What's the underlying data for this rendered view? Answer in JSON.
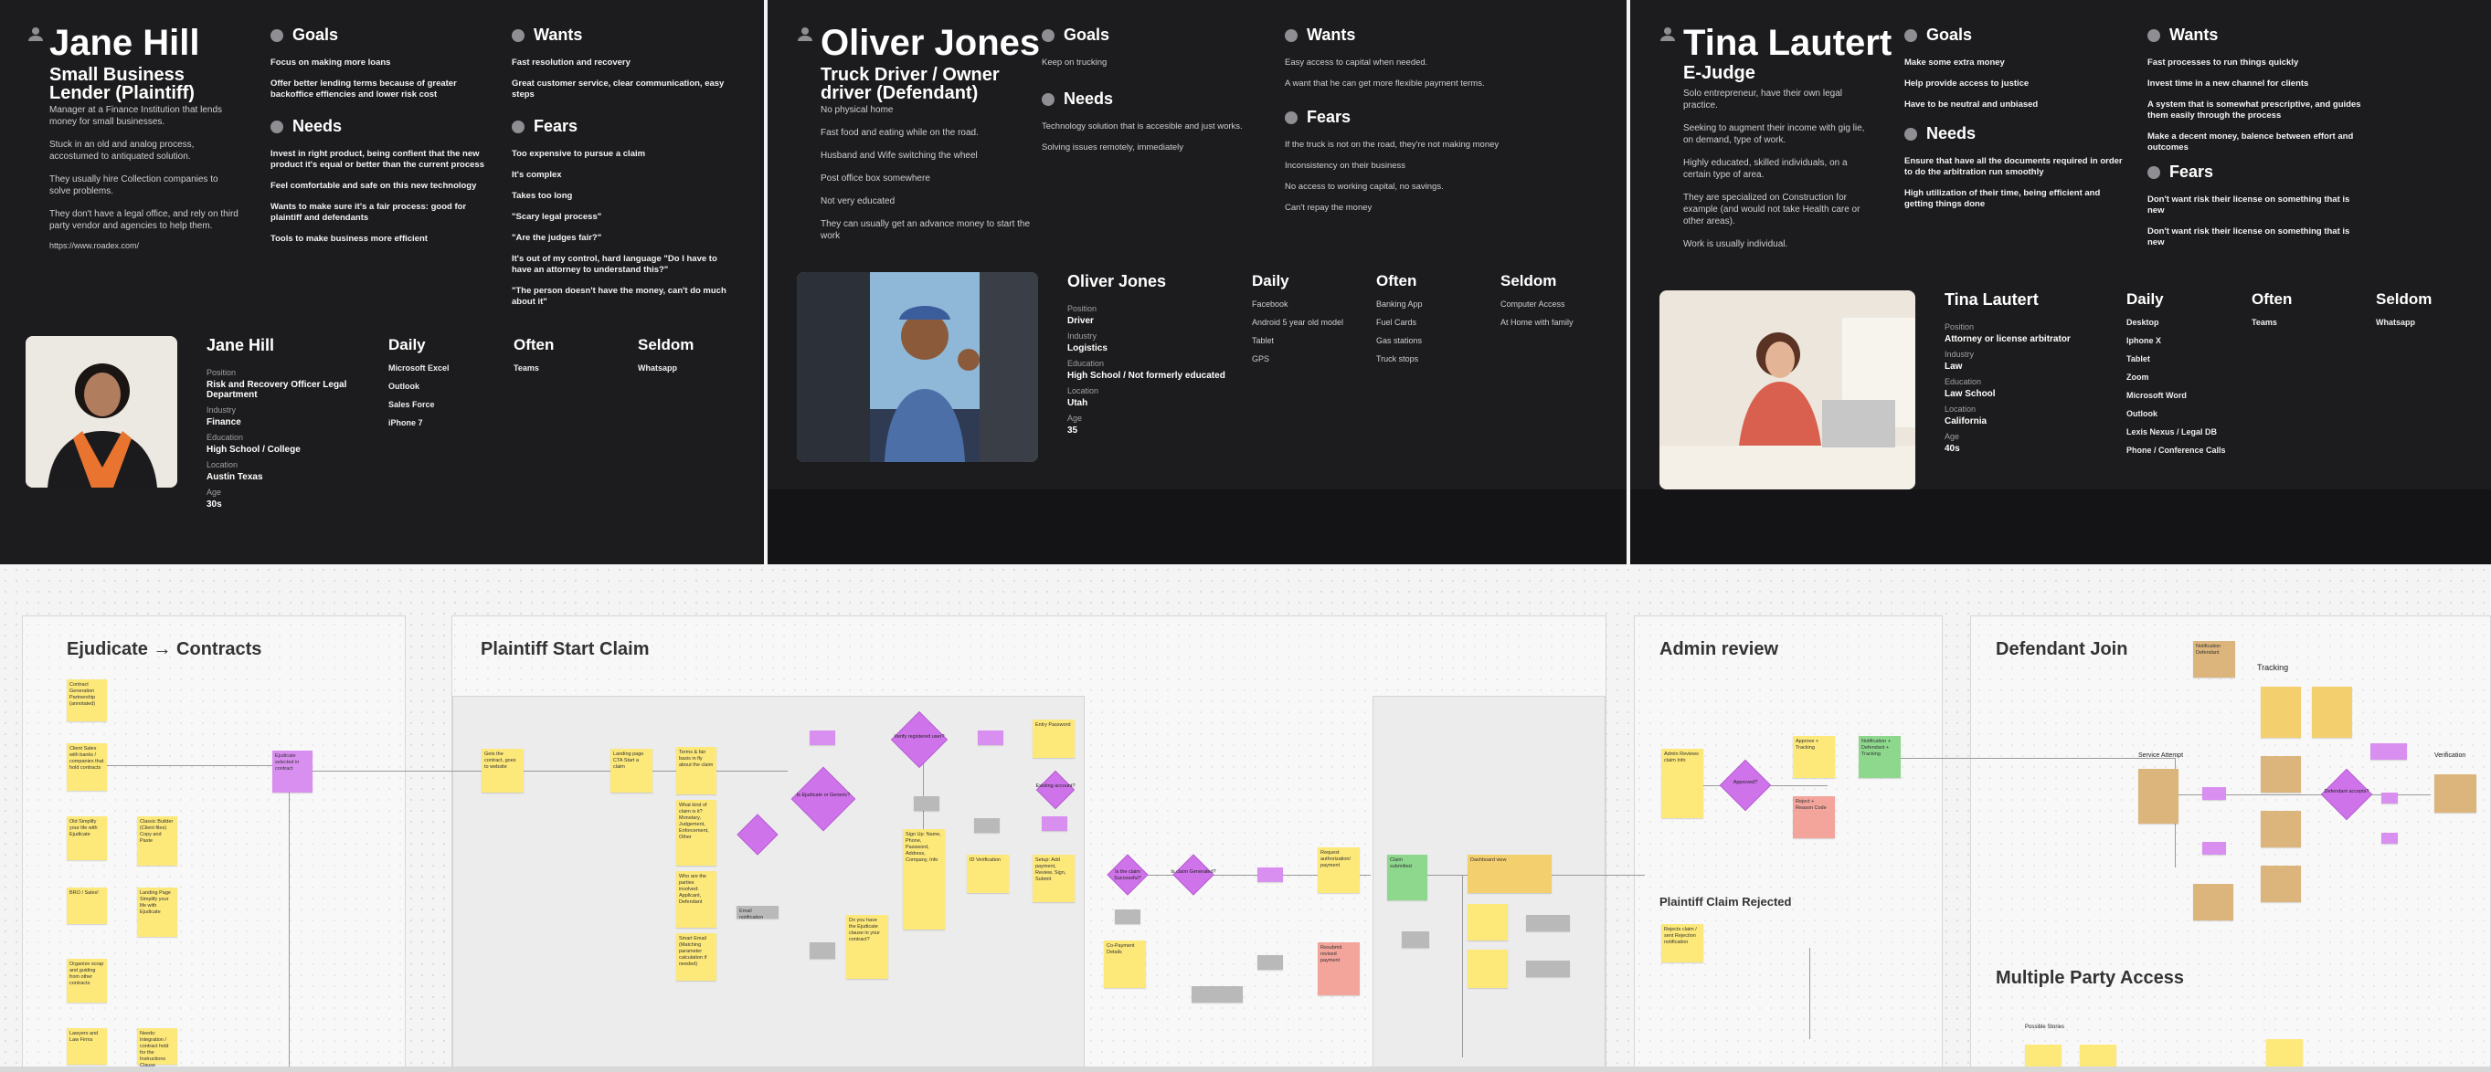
{
  "personas": [
    {
      "name": "Jane Hill",
      "role": "Small Business Lender (Plaintiff)",
      "desc": [
        "Manager at a Finance Institution that lends money for small businesses.",
        "Stuck in an old and analog process, accostumed to antiquated solution.",
        "They usually hire Collection companies to solve problems.",
        "They don't have a legal office, and rely on third party vendor and agencies to help them."
      ],
      "link": "https://www.roadex.com/",
      "goals_title": "Goals",
      "goals": [
        "Focus on making more loans",
        "Offer better lending terms because of greater backoffice effiencies and lower risk cost"
      ],
      "needs_title": "Needs",
      "needs": [
        "Invest in right product, being confient that the new product it's equal or better than the current process",
        "Feel comfortable and safe on this new technology",
        "Wants to make sure it's a fair process: good for plaintiff and defendants",
        "Tools to make business more efficient"
      ],
      "wants_title": "Wants",
      "wants": [
        "Fast resolution and recovery",
        "Great customer service, clear communication, easy steps"
      ],
      "fears_title": "Fears",
      "fears": [
        "Too expensive to pursue a claim",
        "It's complex",
        "Takes too long",
        "\"Scary legal process\"",
        "\"Are the judges fair?\"",
        "It's out of my control, hard language \"Do I have to have an attorney to understand this?\"",
        "\"The person doesn't have the money, can't do much about it\""
      ],
      "card_name": "Jane Hill",
      "position_label": "Position",
      "position": "Risk and Recovery Officer Legal Department",
      "industry_label": "Industry",
      "industry": "Finance",
      "education_label": "Education",
      "education": "High School / College",
      "location_label": "Location",
      "location": "Austin Texas",
      "age_label": "Age",
      "age": "30s",
      "daily_title": "Daily",
      "daily": [
        "Microsoft Excel",
        "Outlook",
        "Sales Force",
        "iPhone 7"
      ],
      "often_title": "Often",
      "often": [
        "Teams"
      ],
      "seldom_title": "Seldom",
      "seldom": [
        "Whatsapp"
      ]
    },
    {
      "name": "Oliver Jones",
      "role": "Truck Driver / Owner driver (Defendant)",
      "desc": [
        "No physical home",
        "Fast food and eating while on the road.",
        "Husband and Wife switching the wheel",
        "Post office box somewhere",
        "Not very educated",
        "They can usually get an advance money to start the work"
      ],
      "goals_title": "Goals",
      "goals": [
        "Keep on trucking"
      ],
      "needs_title": "Needs",
      "needs": [
        "Technology solution that is accesible and just works.",
        "Solving issues remotely, immediately"
      ],
      "wants_title": "Wants",
      "wants": [
        "Easy access to capital when needed.",
        "A want that he can get more flexible payment terms."
      ],
      "fears_title": "Fears",
      "fears": [
        "If the truck is not on the road, they're not making money",
        "Inconsistency on their business",
        "No access to working capital, no savings.",
        "Can't repay the money"
      ],
      "card_name": "Oliver Jones",
      "position_label": "Position",
      "position": "Driver",
      "industry_label": "Industry",
      "industry": "Logistics",
      "education_label": "Education",
      "education": "High School / Not formerly educated",
      "location_label": "Location",
      "location": "Utah",
      "age_label": "Age",
      "age": "35",
      "daily_title": "Daily",
      "daily": [
        "Facebook",
        "Android 5 year old model",
        "Tablet",
        "GPS"
      ],
      "often_title": "Often",
      "often": [
        "Banking App",
        "Fuel Cards",
        "Gas stations",
        "Truck stops"
      ],
      "seldom_title": "Seldom",
      "seldom": [
        "Computer Access",
        "At Home with family"
      ]
    },
    {
      "name": "Tina Lautert",
      "role": "E-Judge",
      "desc": [
        "Solo entrepreneur, have their own legal practice.",
        "Seeking to augment their income with gig lie, on demand, type of work.",
        "Highly educated, skilled individuals, on a certain type of area.",
        "They are specialized on Construction for example (and would not take Health care or other areas).",
        "Work is usually individual."
      ],
      "goals_title": "Goals",
      "goals": [
        "Make some extra money",
        "Help provide access to justice",
        "Have to be neutral and unbiased"
      ],
      "needs_title": "Needs",
      "needs": [
        "Ensure that have all the documents required in order to do the arbitration run smoothly",
        "High utilization of their time, being efficient and getting things done"
      ],
      "wants_title": "Wants",
      "wants": [
        "Fast processes to run things quickly",
        "Invest time in a new channel for clients",
        "A system that is somewhat prescriptive, and guides them easily through the process",
        "Make a decent money, balence between effort and outcomes"
      ],
      "fears_title": "Fears",
      "fears": [
        "Don't want risk their license on something that is new",
        "Don't want risk their license on something that is new"
      ],
      "card_name": "Tina Lautert",
      "position_label": "Position",
      "position": "Attorney or license arbitrator",
      "industry_label": "Industry",
      "industry": "Law",
      "education_label": "Education",
      "education": "Law School",
      "location_label": "Location",
      "location": "California",
      "age_label": "Age",
      "age": "40s",
      "daily_title": "Daily",
      "daily": [
        "Desktop",
        "Iphone X",
        "Tablet",
        "Zoom",
        "Microsoft Word",
        "Outlook",
        "Lexis Nexus / Legal DB",
        "Phone / Conference Calls"
      ],
      "often_title": "Often",
      "often": [
        "Teams"
      ],
      "seldom_title": "Seldom",
      "seldom": [
        "Whatsapp"
      ]
    }
  ],
  "board": {
    "frames": [
      "Ejudicate → Contracts",
      "Plaintiff Start Claim",
      "Admin review",
      "Defendant Join",
      "Plaintiff Claim Rejected",
      "Multiple Party Access"
    ],
    "notes": {
      "c1": "Contract Generation Partnership (annotated)",
      "c2": "Client Sales with banks / companies that hold contracts",
      "c3": "Old Simplify your life with Ejudicate",
      "c4": "BRO / Sales!",
      "c5": "Organize scrap and guiding from other contracts",
      "c6": "Lawyers and Law Firms",
      "c7": "Classic Builder (Client files) Copy and Paste",
      "c8": "Landing Page Simplify your life with Ejudicate",
      "c9": "Needs: Integration / contract hold for the Instructions Clause",
      "c10": "Ejudicate selected in contract",
      "p1": "Gets the contract, goes to website",
      "p2": "Landing page CTA Start a claim",
      "p3": "Terms & fair basis in fly about the claim",
      "p4": "What kind of claim is it? Monetary, Judgement, Enforcement, Other",
      "p5": "Who are the parties involved: Applicant, Defendant",
      "p6": "Smart Email (Matching parameter calculation if needed)",
      "p7": "Entry Password",
      "p8": "Sign Up: Name, Phone, Password, Address, Company, Info",
      "p9": "ID Verification",
      "p10": "Setup: Add payment, Review, Sign, Submit",
      "p11": "Do you have the Ejudicate clause in your contract?",
      "p12": "Email notification",
      "p13": "Co-Payment Details",
      "p14": "Request authorization/ payment",
      "p15": "Resubmit revised payment",
      "p16": "Dashboard view",
      "p17": "Claim submitted",
      "p18": "Is Ejudicate or Generic?",
      "p19": "Verify registered user?",
      "p20": "Existing account?",
      "p21": "Is the claim Successful?",
      "p22": "Is claim Generated?",
      "a1": "Admin Reviews claim Info",
      "a2": "Approve / Cancel / Ask Additional",
      "a3": "Approved?",
      "a4": "Approve + Tracking",
      "a5": "Reject + Reason Code",
      "a6": "Notification + Defendant + Tracking",
      "a7": "Rejects claim / sent Rejection notification",
      "d1": "Notification Defendant",
      "d2": "Tracking",
      "d3": "Service Attempt",
      "d4": "Verification",
      "d5": "Defendant accepts?",
      "d6": "Possible Stories"
    }
  }
}
